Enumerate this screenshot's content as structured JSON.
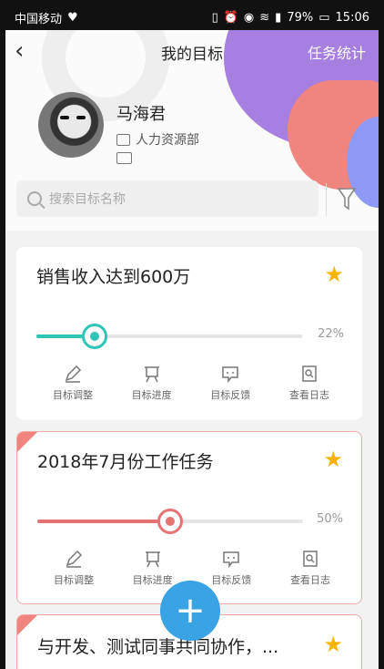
{
  "status_bar": {
    "carrier": "中国移动",
    "battery": "79%",
    "time": "15:06",
    "icons": [
      "heart-icon",
      "vibrate-icon",
      "alarm-icon",
      "eye-icon",
      "wifi-icon",
      "signal-icon",
      "battery-icon"
    ]
  },
  "nav": {
    "back_icon": "chevron-left-icon",
    "title": "我的目标",
    "right_label": "任务统计"
  },
  "user": {
    "name": "马海君",
    "department": "人力资源部",
    "department_icon": "briefcase-icon",
    "card_icon": "id-card-icon"
  },
  "search": {
    "placeholder": "搜索目标名称",
    "filter_icon": "filter-icon"
  },
  "goals": [
    {
      "title": "销售收入达到600万",
      "starred": true,
      "progress_percent": 22,
      "progress_label": "22%",
      "accent": "#2ec4b6",
      "tagged": false
    },
    {
      "title": "2018年7月份工作任务",
      "starred": true,
      "progress_percent": 50,
      "progress_label": "50%",
      "accent": "#e57373",
      "tagged": true
    },
    {
      "title": "与开发、测试同事共同协作，...",
      "starred": true,
      "tagged": true
    }
  ],
  "actions": [
    {
      "label": "目标调整",
      "icon": "edit-icon"
    },
    {
      "label": "目标进度",
      "icon": "easel-icon"
    },
    {
      "label": "目标反馈",
      "icon": "feedback-icon"
    },
    {
      "label": "查看日志",
      "icon": "log-search-icon"
    }
  ],
  "fab": {
    "label": "+",
    "color": "#3aa3e6"
  },
  "colors": {
    "purple": "#a67fe0",
    "salmon": "#f0857f",
    "blue": "#8d99f5",
    "star": "#f4b400"
  }
}
